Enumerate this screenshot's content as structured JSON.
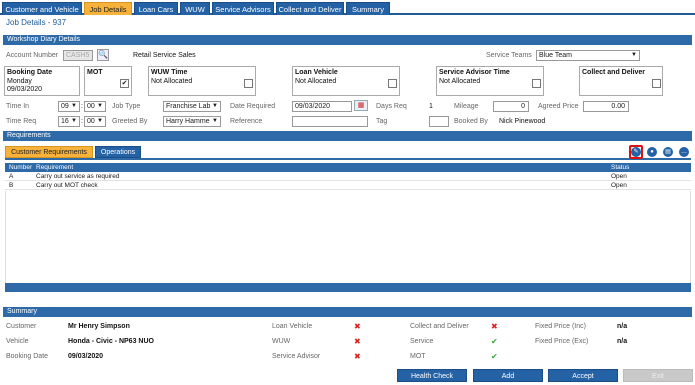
{
  "tabs": [
    "Customer and Vehicle",
    "Job Details",
    "Loan Cars",
    "WUW",
    "Service Advisors",
    "Collect and Deliver",
    "Summary"
  ],
  "active_tab": "Job Details",
  "job_title": "Job Details - 937",
  "workshop_section": "Workshop Diary Details",
  "account_number_label": "Account Number",
  "account_number_value": "CASH5",
  "account_name": "Retail Service Sales",
  "service_teams_label": "Service Teams",
  "service_teams_value": "Blue Team",
  "booking_date_label": "Booking Date",
  "booking_date_day": "Monday",
  "booking_date_value": "09/03/2020",
  "mot_label": "MOT",
  "wuw_time_label": "WUW Time",
  "wuw_time_value": "Not Allocated",
  "loan_vehicle_label": "Loan Vehicle",
  "loan_vehicle_value": "Not Allocated",
  "service_advisor_time_label": "Service Advisor Time",
  "service_advisor_time_value": "Not Allocated",
  "collect_deliver_label": "Collect and Deliver",
  "time_in_label": "Time In",
  "time_in_hour": "09",
  "time_in_min": "00",
  "job_type_label": "Job Type",
  "job_type_value": "Franchise Lab",
  "date_required_label": "Date Required",
  "date_required_value": "09/03/2020",
  "days_req_label": "Days Req",
  "days_req_value": "1",
  "mileage_label": "Mileage",
  "mileage_value": "0",
  "agreed_price_label": "Agreed Price",
  "agreed_price_value": "0.00",
  "time_req_label": "Time Req",
  "time_req_hour": "16",
  "time_req_min": "00",
  "greeted_by_label": "Greeted By",
  "greeted_by_value": "Harry Hamme",
  "reference_label": "Reference",
  "tag_label": "Tag",
  "booked_by_label": "Booked By",
  "booked_by_value": "Nick Pinewood",
  "requirements_section": "Requirements",
  "req_tabs": [
    "Customer Requirements",
    "Operations"
  ],
  "grid_headers": {
    "number": "Number",
    "requirement": "Requirement",
    "status": "Status"
  },
  "rows": [
    {
      "number": "A",
      "requirement": "Carry out service as required",
      "status": "Open"
    },
    {
      "number": "B",
      "requirement": "Carry out MOT check",
      "status": "Open"
    }
  ],
  "summary_section": "Summary",
  "summary": {
    "customer_label": "Customer",
    "customer_value": "Mr Henry Simpson",
    "vehicle_label": "Vehicle",
    "vehicle_value": "Honda - Civic - NP63 NUO",
    "booking_date_label": "Booking Date",
    "booking_date_value": "09/03/2020",
    "loan_vehicle_label": "Loan Vehicle",
    "wuw_label": "WUW",
    "service_advisor_label": "Service Advisor",
    "collect_deliver_label": "Collect and Deliver",
    "service_label": "Service",
    "mot_label": "MOT",
    "fixed_inc_label": "Fixed Price (Inc)",
    "fixed_inc_value": "n/a",
    "fixed_exc_label": "Fixed Price (Exc)",
    "fixed_exc_value": "n/a"
  },
  "buttons": {
    "health_check": "Health Check",
    "add": "Add",
    "accept": "Accept",
    "exit": "Exit"
  },
  "colors": {
    "primary": "#2462a5",
    "active_tab": "#f7b23b",
    "error": "#dd2222",
    "ok": "#3aa53a"
  }
}
